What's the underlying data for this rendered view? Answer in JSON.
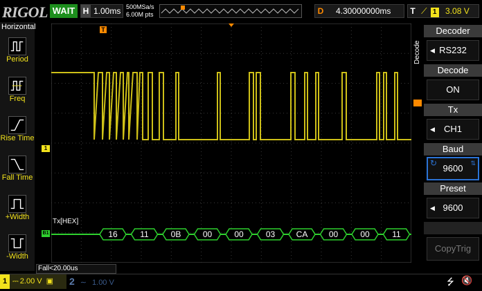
{
  "topbar": {
    "logo": "RIGOL",
    "run_status": "WAIT",
    "horizontal_label": "H",
    "timebase": "1.00ms",
    "sample_rate": "500MSa/s",
    "memory_depth": "6.00M pts",
    "delay_label": "D",
    "delay": "4.30000000ms",
    "trigger_label": "T",
    "trigger_source": "1",
    "trigger_level": "3.08 V"
  },
  "sidebar": {
    "title": "Horizontal",
    "items": [
      {
        "label": "Period",
        "icon": "period-icon"
      },
      {
        "label": "Freq",
        "icon": "freq-icon"
      },
      {
        "label": "Rise Time",
        "icon": "rise-time-icon"
      },
      {
        "label": "Fall Time",
        "icon": "fall-time-icon"
      },
      {
        "label": "+Width",
        "icon": "pos-width-icon"
      },
      {
        "label": "-Width",
        "icon": "neg-width-icon"
      }
    ]
  },
  "measurement": "Fall<20.00us",
  "decoder": {
    "label": "Tx[HEX]",
    "bytes": [
      "16",
      "11",
      "0B",
      "00",
      "00",
      "03",
      "CA",
      "00",
      "00",
      "11"
    ]
  },
  "markers": {
    "trigger": "T",
    "ch1": "1",
    "bus": "B1"
  },
  "right_menu": {
    "vertical_label": "Decode",
    "items": [
      {
        "head": "Decoder",
        "value": "RS232"
      },
      {
        "head": "Decode",
        "value": "ON"
      },
      {
        "head": "Tx",
        "value": "CH1"
      },
      {
        "head": "Baud",
        "value": "9600"
      },
      {
        "head": "Preset",
        "value": "9600"
      },
      {
        "head": "",
        "value": "CopyTrig"
      }
    ]
  },
  "bottombar": {
    "ch1_num": "1",
    "ch1_scale": "2.00 V",
    "ch2_num": "2",
    "ch2_scale": "1.00 V"
  },
  "colors": {
    "ch1": "#f2e21c",
    "bus": "#2ed12e",
    "accent": "#ff8a00",
    "active": "#2b73d6"
  }
}
